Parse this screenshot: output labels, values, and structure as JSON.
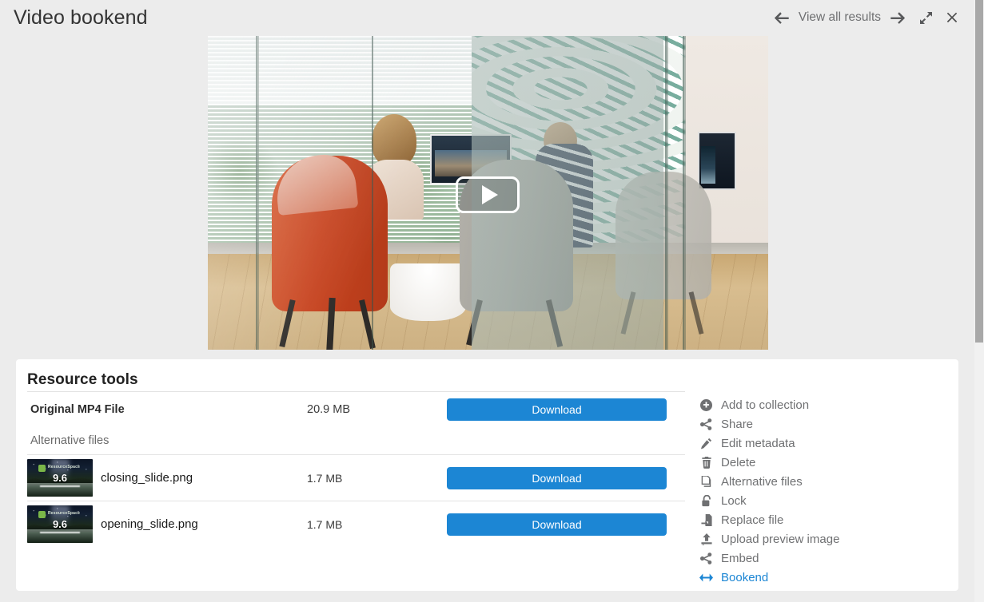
{
  "header": {
    "title": "Video bookend",
    "prev_icon": "arrow-left-icon",
    "results_label": "View all results",
    "next_icon": "arrow-right-icon",
    "expand_icon": "expand-icon",
    "close_icon": "close-icon"
  },
  "preview": {
    "play_icon": "play-icon",
    "media_type": "video"
  },
  "card": {
    "title": "Resource tools",
    "original": {
      "name": "Original MP4 File",
      "size": "20.9 MB",
      "download_label": "Download"
    },
    "alternative_label": "Alternative files",
    "alternatives": [
      {
        "name": "closing_slide.png",
        "size": "1.7 MB",
        "download_label": "Download",
        "thumb_logo": "ResourceSpace",
        "thumb_version": "9.6"
      },
      {
        "name": "opening_slide.png",
        "size": "1.7 MB",
        "download_label": "Download",
        "thumb_logo": "ResourceSpace",
        "thumb_version": "9.6"
      }
    ]
  },
  "tools": [
    {
      "label": "Add to collection",
      "icon": "plus-circle-icon",
      "active": false
    },
    {
      "label": "Share",
      "icon": "share-icon",
      "active": false
    },
    {
      "label": "Edit metadata",
      "icon": "pencil-icon",
      "active": false
    },
    {
      "label": "Delete",
      "icon": "trash-icon",
      "active": false
    },
    {
      "label": "Alternative files",
      "icon": "copy-icon",
      "active": false
    },
    {
      "label": "Lock",
      "icon": "unlock-icon",
      "active": false
    },
    {
      "label": "Replace file",
      "icon": "file-import-icon",
      "active": false
    },
    {
      "label": "Upload preview image",
      "icon": "upload-icon",
      "active": false
    },
    {
      "label": "Embed",
      "icon": "share-icon",
      "active": false
    },
    {
      "label": "Bookend",
      "icon": "arrows-h-icon",
      "active": true
    }
  ],
  "colors": {
    "accent": "#1c86d4",
    "page_bg": "#ececec",
    "card_bg": "#ffffff",
    "text": "#6f7072",
    "title": "#333333"
  }
}
